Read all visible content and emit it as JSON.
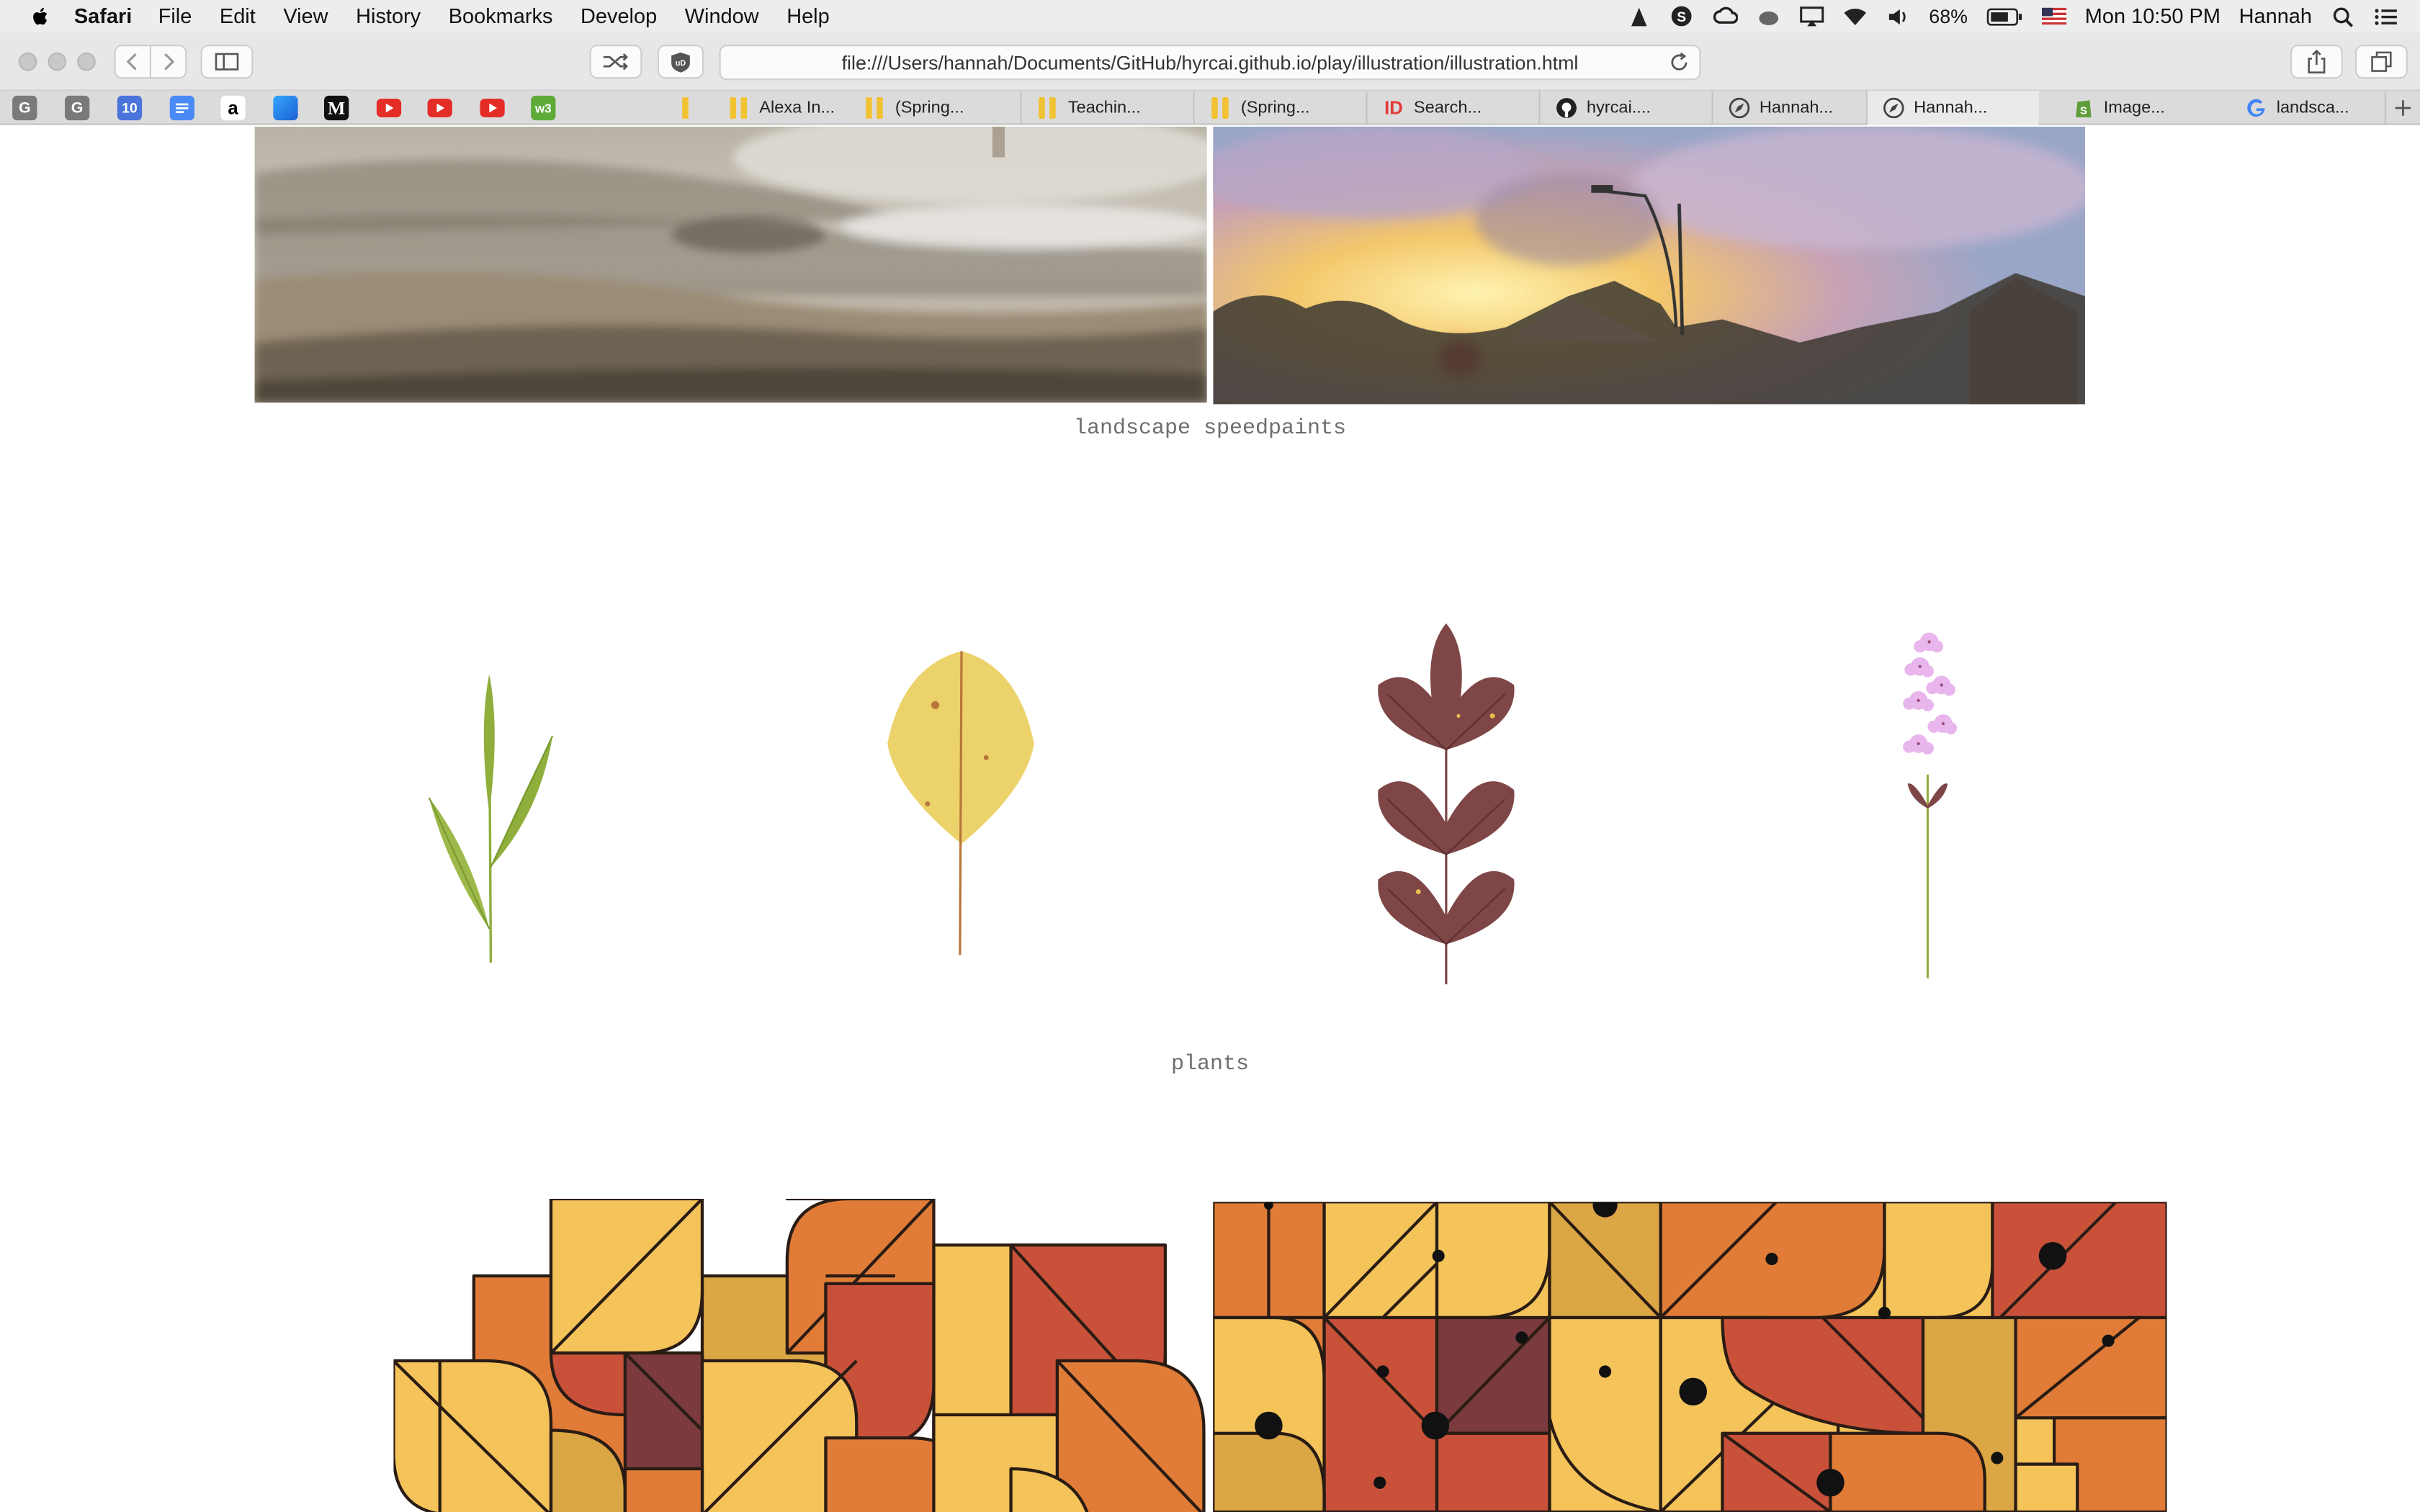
{
  "menubar": {
    "app": "Safari",
    "items": [
      "File",
      "Edit",
      "View",
      "History",
      "Bookmarks",
      "Develop",
      "Window",
      "Help"
    ],
    "battery": "68%",
    "clock": "Mon 10:50 PM",
    "user": "Hannah"
  },
  "toolbar": {
    "url": "file:///Users/hannah/Documents/GitHub/hyrcai.github.io/play/illustration/illustration.html"
  },
  "favorites": [
    "G",
    "G",
    "10",
    "docs",
    "a",
    "blue",
    "M",
    "youtube",
    "youtube",
    "youtube",
    "w3"
  ],
  "tabs": [
    {
      "label": "Alexa In...",
      "icon": "folder-icon"
    },
    {
      "label": "(Spring...",
      "icon": "folder-icon"
    },
    {
      "label": "Teachin...",
      "icon": "folder-icon"
    },
    {
      "label": "(Spring...",
      "icon": "folder-icon"
    },
    {
      "label": "Search...",
      "icon": "id-icon"
    },
    {
      "label": "hyrcai....",
      "icon": "github-icon"
    },
    {
      "label": "Hannah...",
      "icon": "compass-icon"
    },
    {
      "label": "Hannah...",
      "icon": "compass-icon"
    },
    {
      "label": "Image...",
      "icon": "shopify-icon"
    },
    {
      "label": "landsca...",
      "icon": "google-icon"
    }
  ],
  "page": {
    "caption_landscape": "landscape speedpaints",
    "caption_plants": "plants"
  },
  "colors": {
    "leaf_green": "#8fae3c",
    "leaf_yellow": "#ecd26a",
    "leaf_maroon": "#7e4646",
    "flower_pink": "#e8b6ec",
    "pattern_orange": "#e07c37",
    "pattern_yellow": "#f4c35a",
    "pattern_red": "#c9513a",
    "pattern_mustard": "#dba644",
    "pattern_plum": "#7a3a3e"
  }
}
